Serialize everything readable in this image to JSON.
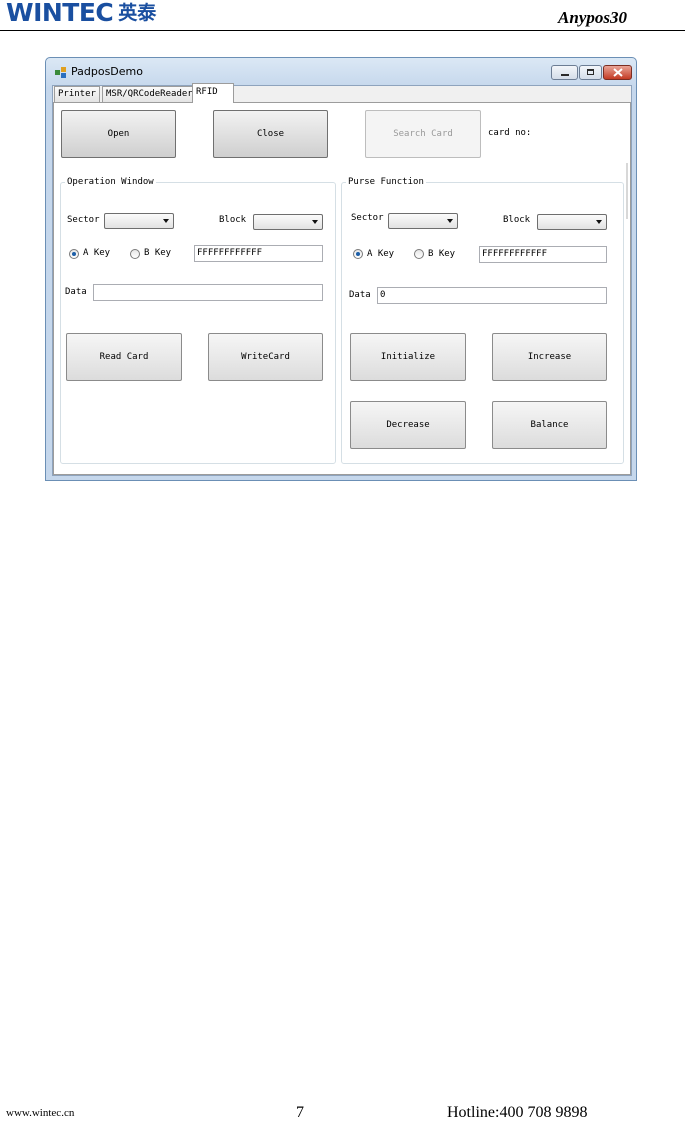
{
  "header": {
    "logo_text": "WINTEC",
    "logo_cn": "英泰",
    "doc_title": "Anypos30"
  },
  "footer": {
    "site": "www.wintec.cn",
    "page": "7",
    "hotline": "Hotline:400 708 9898"
  },
  "window": {
    "title": "PadposDemo",
    "tabs": [
      {
        "label": "Printer"
      },
      {
        "label": "MSR/QRCodeReader"
      },
      {
        "label": "RFID"
      }
    ],
    "active_tab": "RFID",
    "top_bar": {
      "open_label": "Open",
      "close_label": "Close",
      "search_label": "Search Card",
      "card_no_label": "card no:"
    },
    "operation": {
      "title": "Operation Window",
      "sector_label": "Sector",
      "block_label": "Block",
      "a_key_label": "A Key",
      "b_key_label": "B Key",
      "selected_key": "A Key",
      "key_value": "FFFFFFFFFFFF",
      "data_label": "Data",
      "data_value": "",
      "read_label": "Read Card",
      "write_label": "WriteCard"
    },
    "purse": {
      "title": "Purse Function",
      "sector_label": "Sector",
      "block_label": "Block",
      "a_key_label": "A Key",
      "b_key_label": "B Key",
      "selected_key": "A Key",
      "key_value": "FFFFFFFFFFFF",
      "data_label": "Data",
      "data_value": "0",
      "initialize_label": "Initialize",
      "increase_label": "Increase",
      "decrease_label": "Decrease",
      "balance_label": "Balance"
    }
  },
  "colors": {
    "logo_blue": "#1a4fa0",
    "window_frame": "#c5d7ec",
    "close_red": "#c43b24",
    "radio_dot": "#1d5fa8"
  },
  "icons": {
    "app": "app-icon",
    "minimize": "minimize-icon",
    "maximize": "maximize-icon",
    "close": "close-icon",
    "dropdown": "chevron-down-icon"
  }
}
